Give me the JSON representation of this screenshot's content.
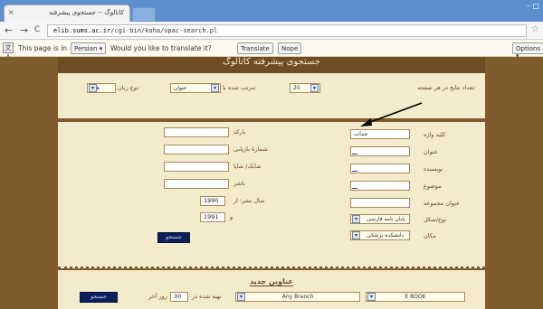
{
  "browser": {
    "tab_title": "کاتالوگ -- جستجوی پیشرفته",
    "tab_close": "×",
    "window_controls": "– □",
    "back": "←",
    "forward": "→",
    "reload": "C",
    "url_host": "elib.sums.ac.ir",
    "url_path": "/cgi-bin/koha/opac-search.pl",
    "star": "☆"
  },
  "translate": {
    "icon": "文A",
    "message": "This page is in",
    "language": "Persian ▾",
    "question": "Would you like to translate it?",
    "translate_btn": "Translate",
    "nope_btn": "Nope",
    "options_btn": "Options ▾"
  },
  "page": {
    "banner": "جستجوی پیشرفته کاتالوگ",
    "top_row": {
      "results_label": "تعداد نتایج در هر صفحه:",
      "results_value": "20",
      "sort_label": "مرتب شده با:",
      "sort_value": "عنوان",
      "lang_label": "نوع زبان:",
      "lang_value": "همه"
    },
    "left": {
      "barcode": "بارکد",
      "callnumber": "شمارهٔ بازیابی",
      "isbn": "شابک/ شاپا",
      "publisher": "ناشر",
      "pubyear": "سال نشر: از",
      "pubyear_from": "1990",
      "and": "و",
      "pubyear_to": "1991",
      "search_btn": "جستجو"
    },
    "right": {
      "keyword": "کلید واژه",
      "keyword_value": "جدات",
      "title": "عنوان",
      "author": "نویسنده",
      "subject": "موضوع",
      "series": "عنوان مجموعه",
      "itemtype": "نوع/شکل",
      "itemtype_value": "پایان نامه فارسی",
      "location": "مکان",
      "location_value": "دانشکده پزشکی"
    },
    "new_titles": {
      "heading": "عناوین جدید",
      "ebook": "E BOOK",
      "branch": "Any Branch",
      "added_label": "تهیه شده در",
      "days": "30",
      "days_suffix": "روز آخر",
      "search_btn": "جستجو"
    },
    "dd": "▾"
  }
}
